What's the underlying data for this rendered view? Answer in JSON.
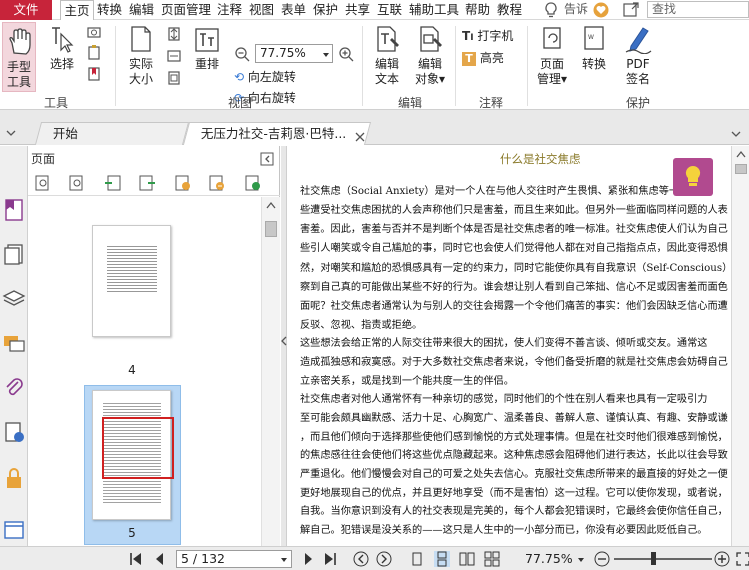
{
  "menubar": {
    "file": "文件",
    "items": [
      "主页",
      "转换",
      "编辑",
      "页面管理",
      "注释",
      "视图",
      "表单",
      "保护",
      "共享",
      "互联",
      "辅助工具",
      "帮助",
      "教程"
    ],
    "tell_me": "告诉",
    "search_placeholder": "查找"
  },
  "ribbon": {
    "hand_tool": "手型\n工具",
    "select": "选择",
    "actual_size": "实际\n大小",
    "reflow": "重排",
    "zoom_value": "77.75%",
    "rotate_left": "向左旋转",
    "rotate_right": "向右旋转",
    "edit_text": "编辑\n文本",
    "edit_object": "编辑\n对象",
    "typewriter": "打字机",
    "highlight": "高亮",
    "page_manage": "页面\n管理",
    "convert": "转换",
    "pdf_sign": "PDF\n签名",
    "groups": {
      "tools": "工具",
      "view": "视图",
      "edit": "编辑",
      "comment": "注释",
      "protect": "保护"
    }
  },
  "tabs": {
    "start": "开始",
    "doc": "无压力社交-吉莉恩·巴特..."
  },
  "pages_panel": {
    "title": "页面",
    "thumbs": [
      {
        "num": "4"
      },
      {
        "num": "5"
      }
    ]
  },
  "document": {
    "heading": "什么是社交焦虑",
    "lines": [
      "    社交焦虑（Social  Anxiety）是对一个人在与他人交往时产生畏惧、紧张和焦虑等一现象",
      "些遭受社交焦虑困扰的人会声称他们只是害羞，而且生来如此。但另外一些面临同样问题的人表",
      "害羞。因此，害羞与否并不是判断个体是否是社交焦虑者的唯一标准。社交焦虑使人们认为自己",
      "些引人嘲笑或令自己尴尬的事，同时它也会使人们觉得他人都在对自己指指点点，因此变得恐惧",
      "然，对嘲笑和尴尬的恐惧感具有一定的约束力，同时它能使你具有自我意识（Self-Conscious）",
      "察到自己真的可能做出某些不好的行为。谁会想让别人看到自己笨拙、信心不足或因害羞而面色",
      "面呢？社交焦虑者通常认为与别人的交往会揭露一个令他们痛苦的事实：他们会因缺乏信心而遭",
      "反驳、忽视、指责或拒绝。",
      "    这些想法会给正常的人际交往带来很大的困扰，使人们变得不善言谈、倾听或交友。通常这",
      "造成孤独感和寂寞感。对于大多数社交焦虑者来说，令他们备受折磨的就是社交焦虑会妨碍自己",
      "立亲密关系，或是找到一个能共度一生的伴侣。",
      "    社交焦虑者对他人通常怀有一种亲切的感觉，同时他们的个性在别人看来也具有一定吸引力",
      "至可能会颇具幽默感、活力十足、心胸宽广、温柔善良、善解人意、谨慎认真、有趣、安静或谦",
      "，而且他们倾向于选择那些使他们感到愉悦的方式处理事情。但是在社交时他们很难感到愉悦，",
      "的焦虑感往往会使他们将这些优点隐藏起来。这种焦虑感会阻碍他们进行表达，长此以往会导致",
      "严重退化。他们慢慢会对自己的可爱之处失去信心。克服社交焦虑所带来的最直接的好处之一便",
      "更好地展现自己的优点，并且更好地享受（而不是害怕）这一过程。它可以使你发现，或者说，",
      "自我。当你意识到没有人的社交表现是完美的，每个人都会犯错误时，它最终会使你信任自己，",
      "解自己。犯错误是没关系的——这只是人生中的一小部分而已，你没有必要因此贬低自己。"
    ]
  },
  "statusbar": {
    "page_nav": "5 / 132",
    "zoom": "77.75%"
  }
}
